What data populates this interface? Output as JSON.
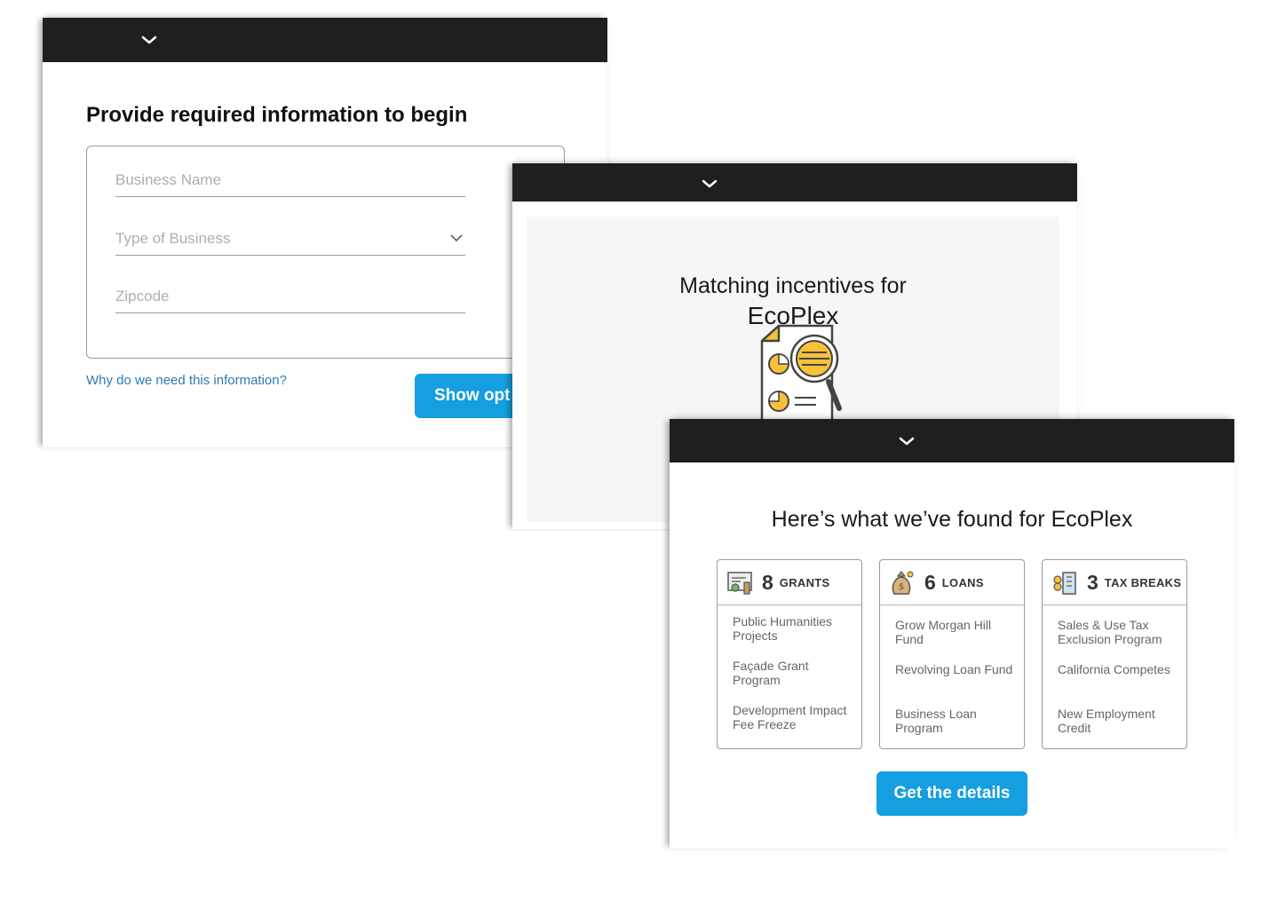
{
  "form_panel": {
    "title": "Provide required information to begin",
    "business_name_placeholder": "Business Name",
    "business_type_placeholder": "Type of Business",
    "zipcode_placeholder": "Zipcode",
    "why_link": "Why do we need this information?",
    "submit_label": "Show opt"
  },
  "matching_panel": {
    "heading_line1": "Matching incentives for",
    "business_name": "EcoPlex",
    "illustration_icon": "document-magnifier-icon"
  },
  "results_panel": {
    "heading": "Here’s what we’ve found for EcoPlex",
    "cards": [
      {
        "icon": "grant-certificate-icon",
        "count": "8",
        "kind": "GRANTS",
        "items": [
          "Public Humanities Projects",
          "Façade Grant Program",
          "Development Impact Fee Freeze"
        ]
      },
      {
        "icon": "money-bag-icon",
        "count": "6",
        "kind": "LOANS",
        "items": [
          "Grow Morgan Hill Fund",
          "Revolving Loan Fund",
          "Business Loan Program"
        ]
      },
      {
        "icon": "coins-building-icon",
        "count": "3",
        "kind": "TAX BREAKS",
        "items": [
          "Sales & Use Tax Exclusion Program",
          "California Competes",
          "New Employment Credit"
        ]
      }
    ],
    "cta_label": "Get the details"
  },
  "colors": {
    "topbar": "#1f1f1f",
    "accent": "#159ee0",
    "link": "#2c7bb8",
    "highlight": "#f7c23a"
  }
}
